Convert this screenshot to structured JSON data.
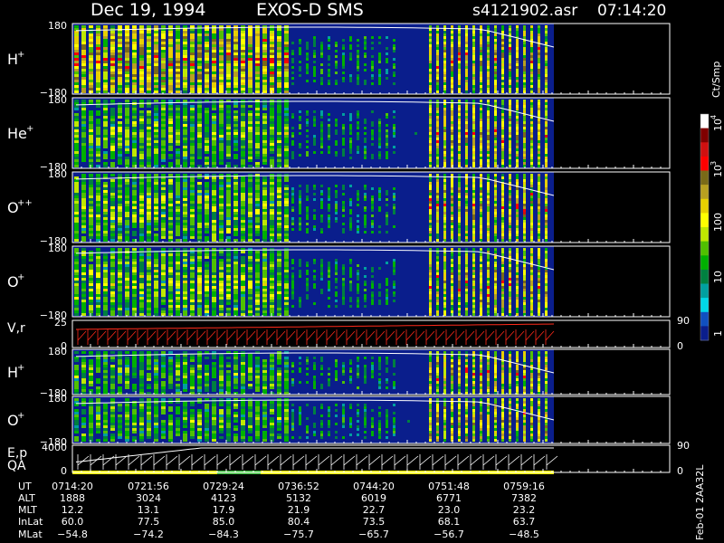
{
  "header": {
    "date": "Dec 19, 1994",
    "instrument": "EXOS-D SMS",
    "file": "s4121902.asr",
    "time": "07:14:20"
  },
  "colors": {
    "background": "#000000",
    "text": "#ffffff",
    "panel_fill": "#0a1e8c",
    "trace": "#ff2a1a"
  },
  "panels": [
    {
      "id": "H+",
      "label": "H",
      "sup": "+",
      "ymax": "180",
      "ymin": "−180"
    },
    {
      "id": "He+",
      "label": "He",
      "sup": "+",
      "ymax": "180",
      "ymin": "−180"
    },
    {
      "id": "O++",
      "label": "O",
      "sup": "++",
      "ymax": "180",
      "ymin": "−180"
    },
    {
      "id": "O+",
      "label": "O",
      "sup": "+",
      "ymax": "180",
      "ymin": "−180"
    },
    {
      "id": "Vr",
      "label": "V,r",
      "sup": "",
      "ymax": "25",
      "ymin": "0",
      "right_top": "90",
      "right_bottom": "0"
    },
    {
      "id": "H+2",
      "label": "H",
      "sup": "+",
      "ymax": "180",
      "ymin": "−180"
    },
    {
      "id": "O+2",
      "label": "O",
      "sup": "+",
      "ymax": "180",
      "ymin": "−180"
    },
    {
      "id": "Ep",
      "label": "E,p",
      "label2": "QA",
      "sup": "",
      "ymax": "4000",
      "ymin": "0",
      "right_top": "90",
      "right_bottom": "0"
    }
  ],
  "colorbar": {
    "unit": "Ct/Smp",
    "labels": [
      "10",
      "10",
      "100",
      "10",
      "1"
    ],
    "exponents": [
      "4",
      "3",
      "",
      "",
      ""
    ],
    "colors": [
      "#ffffff",
      "#800000",
      "#d01010",
      "#ff0000",
      "#7a6a18",
      "#b8a020",
      "#e8d000",
      "#ffff00",
      "#c0e800",
      "#50c000",
      "#00b000",
      "#008040",
      "#00a0a0",
      "#00d8e8",
      "#1050c0",
      "#0a1e8c"
    ]
  },
  "time_axis": {
    "row_labels": [
      "UT",
      "ALT",
      "MLT",
      "InLat",
      "MLat"
    ],
    "ticks": [
      {
        "UT": "0714:20",
        "ALT": "1888",
        "MLT": "12.2",
        "InLat": "60.0",
        "MLat": "−54.8"
      },
      {
        "UT": "0721:56",
        "ALT": "3024",
        "MLT": "13.1",
        "InLat": "77.5",
        "MLat": "−74.2"
      },
      {
        "UT": "0729:24",
        "ALT": "4123",
        "MLT": "17.9",
        "InLat": "85.0",
        "MLat": "−84.3"
      },
      {
        "UT": "0736:52",
        "ALT": "5132",
        "MLT": "21.9",
        "InLat": "80.4",
        "MLat": "−75.7"
      },
      {
        "UT": "0744:20",
        "ALT": "6019",
        "MLT": "22.7",
        "InLat": "73.5",
        "MLat": "−65.7"
      },
      {
        "UT": "0751:48",
        "ALT": "6771",
        "MLT": "23.0",
        "InLat": "68.1",
        "MLat": "−56.7"
      },
      {
        "UT": "0759:16",
        "ALT": "7382",
        "MLT": "23.2",
        "InLat": "63.7",
        "MLat": "−48.5"
      }
    ]
  },
  "footer_vertical": "Feb-01 2AA32L"
}
